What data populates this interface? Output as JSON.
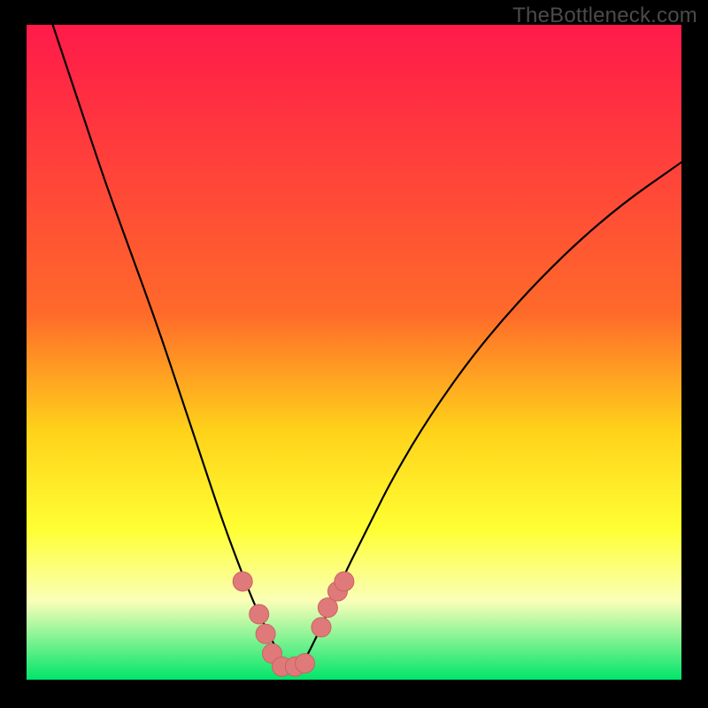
{
  "watermark": "TheBottleneck.com",
  "colors": {
    "bg": "#000000",
    "grad_top": "#ff1a4a",
    "grad_mid1": "#ff6a2a",
    "grad_mid2": "#ffd21a",
    "grad_mid3": "#ffff33",
    "grad_mid4": "#faffb8",
    "grad_bottom": "#00e56a",
    "curve": "#000000",
    "marker_fill": "#e07a7a",
    "marker_stroke": "#c96262"
  },
  "chart_data": {
    "type": "line",
    "title": "",
    "xlabel": "",
    "ylabel": "",
    "xlim": [
      0,
      100
    ],
    "ylim": [
      0,
      100
    ],
    "series": [
      {
        "name": "bottleneck-curve",
        "x": [
          4,
          8,
          12,
          16,
          20,
          24,
          27,
          30,
          33,
          35,
          37,
          38,
          39,
          40.5,
          42,
          45,
          48,
          52,
          56,
          62,
          70,
          80,
          90,
          100
        ],
        "y": [
          100,
          88,
          76,
          65,
          54,
          42,
          33,
          24,
          16,
          11,
          7,
          5,
          2,
          1,
          2,
          8,
          15,
          23,
          31,
          41,
          52,
          63,
          72,
          79
        ]
      }
    ],
    "markers": {
      "name": "highlighted-points",
      "x": [
        33,
        35.5,
        36.5,
        37.5,
        39,
        41,
        42.5,
        45,
        46,
        47.5,
        48.5
      ],
      "y": [
        15,
        10,
        7,
        4,
        2,
        2,
        2.5,
        8,
        11,
        13.5,
        15
      ]
    },
    "gradient_stops": [
      {
        "offset": 0.0,
        "key": "grad_top"
      },
      {
        "offset": 0.44,
        "key": "grad_mid1"
      },
      {
        "offset": 0.62,
        "key": "grad_mid2"
      },
      {
        "offset": 0.77,
        "key": "grad_mid3"
      },
      {
        "offset": 0.88,
        "key": "grad_mid4"
      },
      {
        "offset": 1.0,
        "key": "grad_bottom"
      }
    ]
  }
}
